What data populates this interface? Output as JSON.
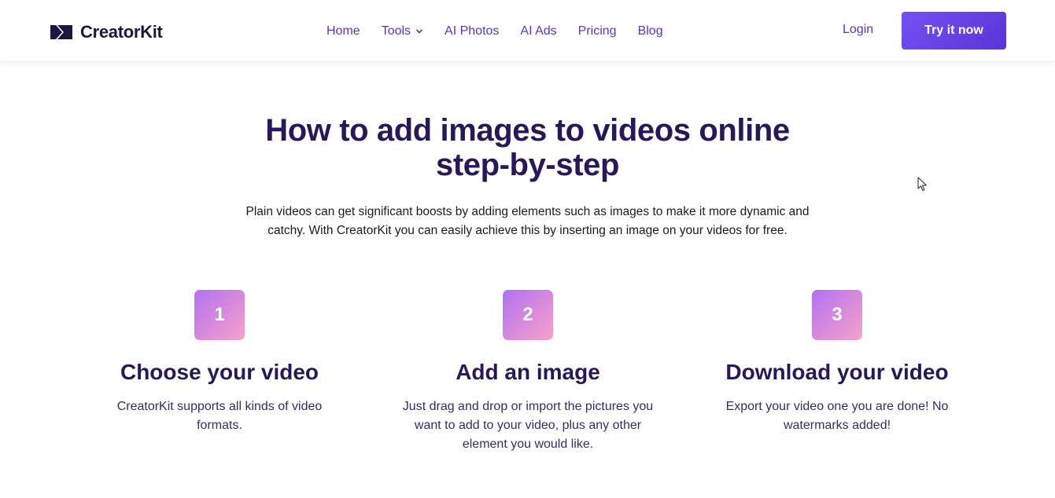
{
  "header": {
    "brand": "CreatorKit",
    "nav": [
      {
        "label": "Home"
      },
      {
        "label": "Tools",
        "has_dropdown": true
      },
      {
        "label": "AI Photos"
      },
      {
        "label": "AI Ads"
      },
      {
        "label": "Pricing"
      },
      {
        "label": "Blog"
      }
    ],
    "login_label": "Login",
    "cta_label": "Try it now"
  },
  "hero": {
    "title_line1": "How to add images to videos online",
    "title_line2": "step-by-step",
    "description": "Plain videos can get significant boosts by adding elements such as images to make it more dynamic and catchy. With CreatorKit you can easily achieve this by inserting an image on your videos for free."
  },
  "steps": [
    {
      "number": "1",
      "title": "Choose your video",
      "description": "CreatorKit supports all kinds of video formats."
    },
    {
      "number": "2",
      "title": "Add an image",
      "description": "Just drag and drop or import the pictures you want to add to your video, plus any other element you would like."
    },
    {
      "number": "3",
      "title": "Download your video",
      "description": "Export your video one you are done! No watermarks added!"
    }
  ],
  "icons": {
    "logo": "creatorkit-logo-icon",
    "dropdown": "chevron-down-icon",
    "cursor": "mouse-pointer-icon"
  },
  "colors": {
    "nav_link": "#5b34c4",
    "cta_background": "#6a45e8",
    "heading": "#2a1758",
    "badge_gradient_start": "#b072f3",
    "badge_gradient_end": "#f5a2cc"
  }
}
